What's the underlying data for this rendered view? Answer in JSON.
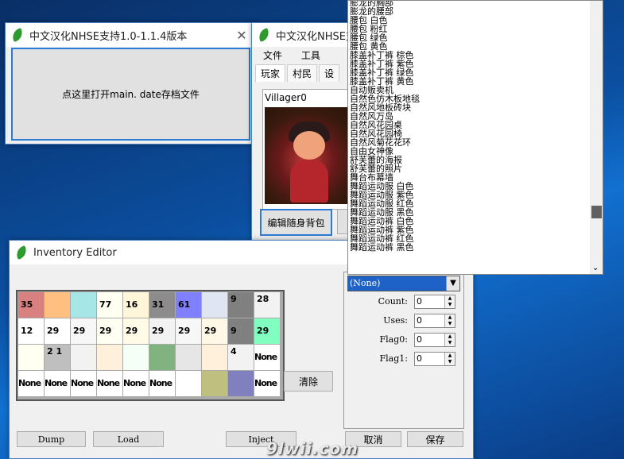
{
  "window1": {
    "title": "中文汉化NHSE支持1.0-1.1.4版本",
    "open_button": "点这里打开main. date存档文件"
  },
  "window2": {
    "title": "中文汉化NHSE支",
    "menu": [
      "文件",
      "工具"
    ],
    "tabs": [
      "玩家",
      "村民",
      "设"
    ],
    "villager_name": "Villager0",
    "edit_bag_button": "编辑随身背包"
  },
  "item_list": [
    "膨龙的胸部",
    "膨龙的腰部",
    "腰包  白色",
    "腰包  粉红",
    "腰包  绿色",
    "腰包  黄色",
    "膝盖补丁裤  棕色",
    "膝盖补丁裤  紫色",
    "膝盖补丁裤  绿色",
    "膝盖补丁裤  黄色",
    "自动贩卖机",
    "自然色仿木板地毯",
    "自然风地板砖块",
    "自然风万岛",
    "自然风花园桌",
    "自然风花园椅",
    "自然风菊花花环",
    "自由女神像",
    "舒芙蕾的海报",
    "舒芙蕾的照片",
    "舞台布幕墙",
    "舞蹈运动服  白色",
    "舞蹈运动服  紫色",
    "舞蹈运动服  红色",
    "舞蹈运动服  黑色",
    "舞蹈运动裤  白色",
    "舞蹈运动裤  紫色",
    "舞蹈运动裤  红色",
    "舞蹈运动裤  黑色"
  ],
  "inventory": {
    "title": "Inventory Editor",
    "cells": [
      {
        "t": "35",
        "c": "#d98080"
      },
      {
        "t": "",
        "c": "#ffbf80"
      },
      {
        "t": "",
        "c": "#a6e6e6"
      },
      {
        "t": "77",
        "c": "#fffff2"
      },
      {
        "t": "16",
        "c": "#fff5d9"
      },
      {
        "t": "31",
        "c": "#8c8c8c"
      },
      {
        "t": "61",
        "c": "#8080ff"
      },
      {
        "t": "",
        "c": "#dfe6f2"
      },
      {
        "t": "9",
        "c": "#808080",
        "tl": true
      },
      {
        "t": "28",
        "c": "#f2f2f2",
        "tl": true
      },
      {
        "t": "12",
        "c": "#ffffff"
      },
      {
        "t": "29",
        "c": "#ffffff"
      },
      {
        "t": "29",
        "c": "#f7f7f7"
      },
      {
        "t": "29",
        "c": "#fffff2"
      },
      {
        "t": "29",
        "c": "#fffbe6"
      },
      {
        "t": "29",
        "c": "#f2f2f2"
      },
      {
        "t": "29",
        "c": "#f7f7f7"
      },
      {
        "t": "29",
        "c": "#fff8e6"
      },
      {
        "t": "9",
        "c": "#808080"
      },
      {
        "t": "29",
        "c": "#80ffc0"
      },
      {
        "t": "",
        "c": "#fffff2"
      },
      {
        "t": "2   1",
        "c": "#bfbfbf",
        "tl": true
      },
      {
        "t": "",
        "c": "#f2f2f2"
      },
      {
        "t": "",
        "c": "#fff0dc"
      },
      {
        "t": "",
        "c": "#f5fff5"
      },
      {
        "t": "",
        "c": "#80b380"
      },
      {
        "t": "",
        "c": "#e6e6e6"
      },
      {
        "t": "",
        "c": "#fff0dc"
      },
      {
        "t": "4",
        "c": "#f2f2f2",
        "tl": true
      },
      {
        "t": "None",
        "c": "#ffffff"
      },
      {
        "t": "None",
        "c": "#ffffff"
      },
      {
        "t": "None",
        "c": "#ffffff"
      },
      {
        "t": "None",
        "c": "#ffffff"
      },
      {
        "t": "None",
        "c": "#ffffff"
      },
      {
        "t": "None",
        "c": "#ffffff"
      },
      {
        "t": "None",
        "c": "#ffffff"
      },
      {
        "t": "",
        "c": "#ffffff"
      },
      {
        "t": "",
        "c": "#bfbf80"
      },
      {
        "t": "",
        "c": "#8080bf"
      },
      {
        "t": "None",
        "c": "#ffffff"
      }
    ],
    "clear_button": "清除",
    "combo_value": "(None)",
    "fields": [
      {
        "label": "Count:",
        "value": "0"
      },
      {
        "label": "Uses:",
        "value": "0"
      },
      {
        "label": "Flag0:",
        "value": "0"
      },
      {
        "label": "Flag1:",
        "value": "0"
      }
    ],
    "dump_button": "Dump",
    "load_button": "Load",
    "inject_button": "Inject",
    "cancel_button": "取消",
    "save_button": "保存"
  },
  "watermark": "9lwii.com"
}
